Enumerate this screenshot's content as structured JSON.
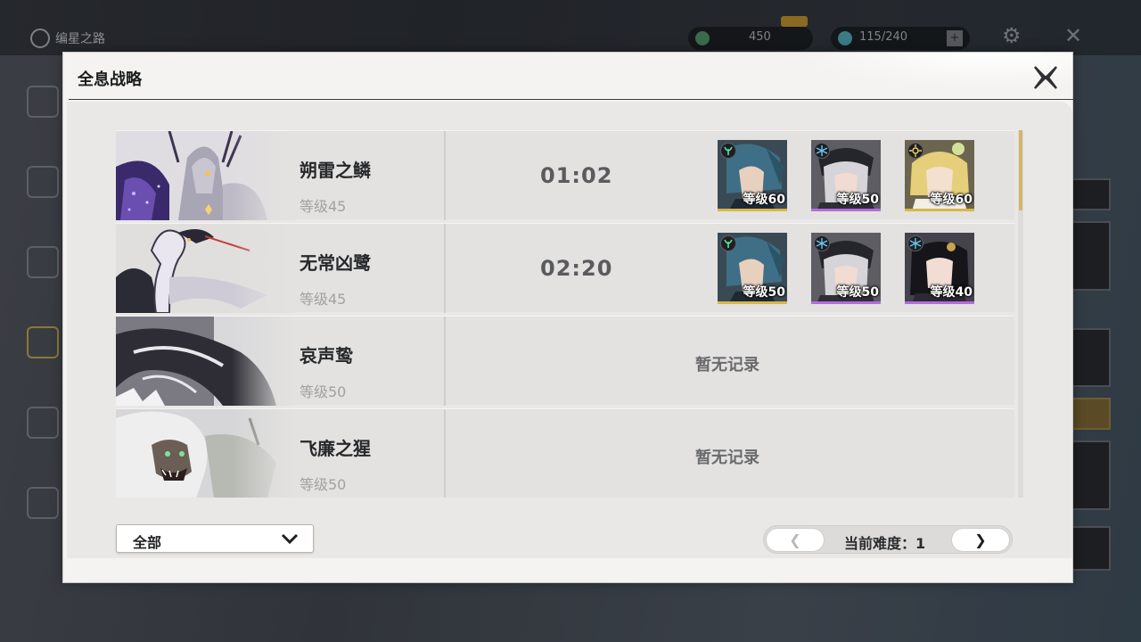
{
  "background": {
    "home_label": "编星之路",
    "currency_1": "450",
    "currency_2": "115/240"
  },
  "dialog": {
    "title": "全息战略"
  },
  "bosses": [
    {
      "name": "朔雷之鳞",
      "level": "等级45",
      "time": "01:02",
      "team": [
        {
          "level": "等级60",
          "element": "aero-icon",
          "rarity": "gold"
        },
        {
          "level": "等级50",
          "element": "glacio-icon",
          "rarity": "purple"
        },
        {
          "level": "等级60",
          "element": "spectro-icon",
          "rarity": "gold"
        }
      ]
    },
    {
      "name": "无常凶鹭",
      "level": "等级45",
      "time": "02:20",
      "team": [
        {
          "level": "等级50",
          "element": "aero-icon",
          "rarity": "gold"
        },
        {
          "level": "等级50",
          "element": "glacio-icon",
          "rarity": "purple"
        },
        {
          "level": "等级40",
          "element": "glacio-icon",
          "rarity": "purple"
        }
      ]
    },
    {
      "name": "哀声鸷",
      "level": "等级50",
      "no_record": "暂无记录"
    },
    {
      "name": "飞廉之猩",
      "level": "等级50",
      "no_record": "暂无记录"
    }
  ],
  "filter": {
    "selected": "全部"
  },
  "difficulty": {
    "label": "当前难度：",
    "value": "1",
    "prev_glyph": "❮",
    "next_glyph": "❯"
  },
  "colors": {
    "gold_rarity": "#d9b64a",
    "purple_rarity": "#b56bdb",
    "panel_bg": "#f4f3f1",
    "row_bg": "#e3e2e0"
  }
}
